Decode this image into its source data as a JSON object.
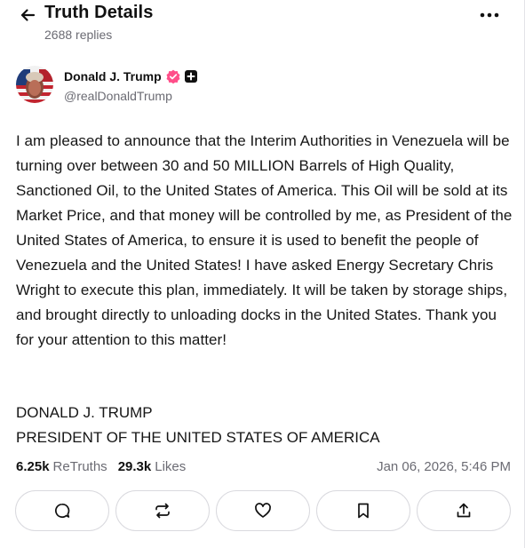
{
  "header": {
    "title": "Truth Details",
    "replies": "2688 replies"
  },
  "author": {
    "name": "Donald J. Trump",
    "handle": "@realDonaldTrump"
  },
  "post": {
    "text": "I am pleased to announce that the Interim Authorities in Venezuela will be turning over between 30 and 50 MILLION Barrels of High Quality, Sanctioned Oil, to the United States of America. This Oil will be sold at its Market Price, and that money will be controlled by me, as President of the United States of America, to ensure it is used to benefit the people of Venezuela and the United States! I have asked Energy Secretary Chris Wright to execute this plan, immediately. It will be taken by storage ships, and brought directly to unloading docks in the United States. Thank you for your attention to this matter!",
    "signature_name": "DONALD J. TRUMP",
    "signature_title": "PRESIDENT OF THE UNITED STATES OF AMERICA"
  },
  "stats": {
    "retruths_count": "6.25k",
    "retruths_label": "ReTruths",
    "likes_count": "29.3k",
    "likes_label": "Likes",
    "timestamp": "Jan 06, 2026, 5:46 PM"
  },
  "actions": [
    "reply-icon",
    "retruth-icon",
    "like-icon",
    "bookmark-icon",
    "share-icon"
  ],
  "colors": {
    "verified_badge": "#ff4e89",
    "muted_text": "#6b6b73",
    "border": "#d9d9de"
  }
}
